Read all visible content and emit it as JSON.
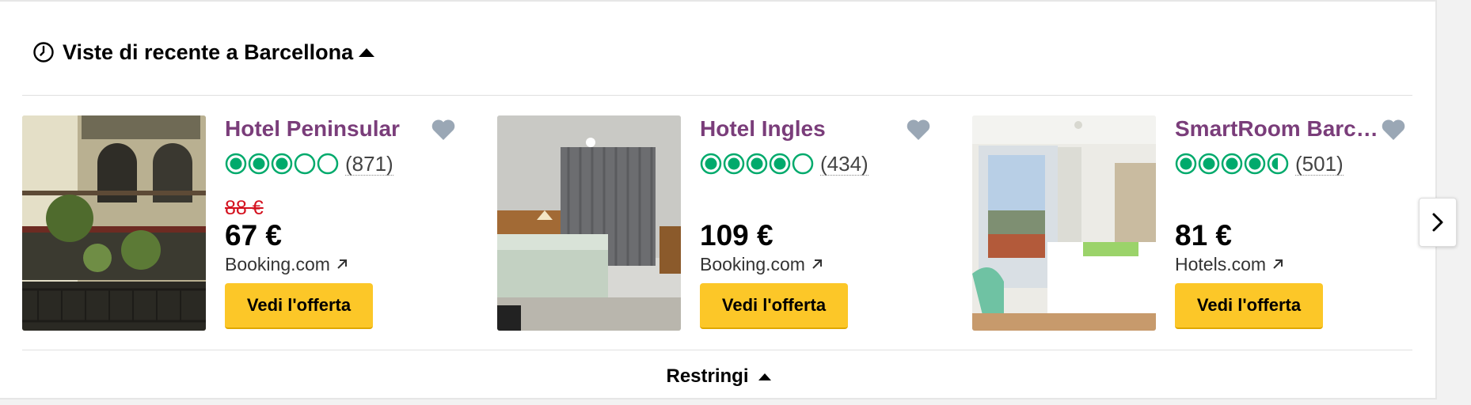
{
  "header": {
    "title": "Viste di recente a Barcellona"
  },
  "cards": [
    {
      "name": "Hotel Peninsular",
      "rating_bubbles": 3,
      "reviews": "(871)",
      "old_price": "88 €",
      "price": "67 €",
      "provider": "Booking.com",
      "button_label": "Vedi l'offerta"
    },
    {
      "name": "Hotel Ingles",
      "rating_bubbles": 4,
      "reviews": "(434)",
      "old_price": "",
      "price": "109 €",
      "provider": "Booking.com",
      "button_label": "Vedi l'offerta"
    },
    {
      "name": "SmartRoom Barc…",
      "rating_bubbles": 4.5,
      "reviews": "(501)",
      "old_price": "",
      "price": "81 €",
      "provider": "Hotels.com",
      "button_label": "Vedi l'offerta"
    }
  ],
  "footer": {
    "collapse_label": "Restringi"
  },
  "colors": {
    "hotel_name": "#7a3d7a",
    "rating_bubble": "#00aa6c",
    "old_price": "#d4111e",
    "button": "#fcc728",
    "heart": "#9aa7b5"
  },
  "icons": [
    "clock-icon",
    "caret-up-icon",
    "heart-icon",
    "external-link-icon",
    "chevron-right-icon"
  ]
}
